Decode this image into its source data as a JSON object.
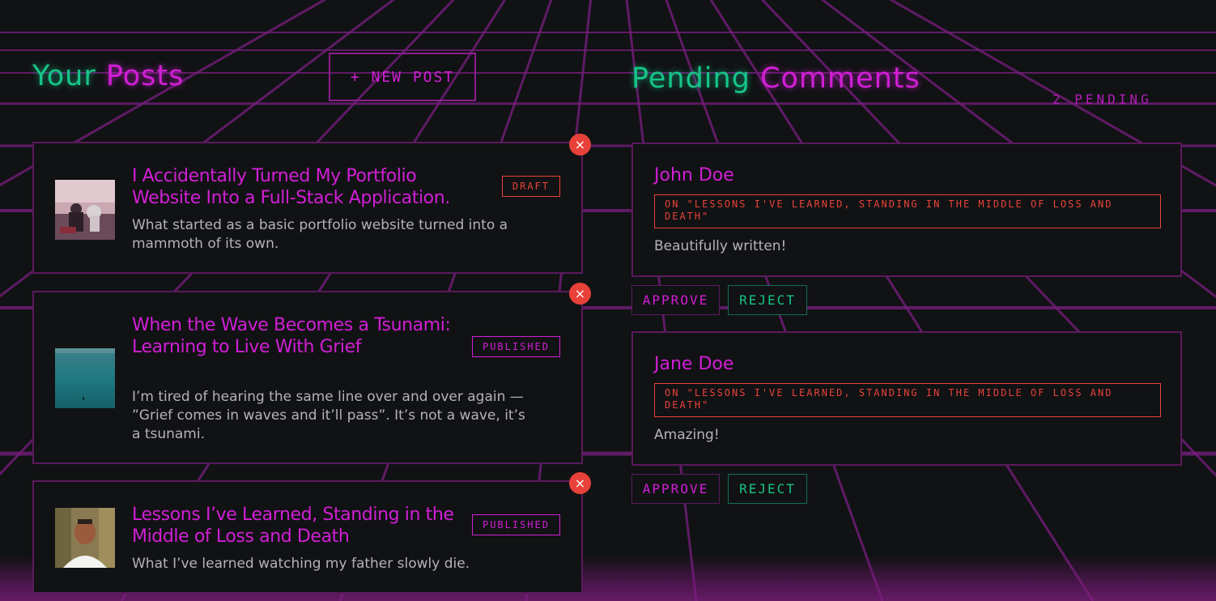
{
  "colors": {
    "background": "#111214",
    "neon_magenta": "#d21fd6",
    "neon_green": "#16c489",
    "alert_red": "#e8433a",
    "card_border": "#5a1a5c",
    "grid_line": "#7a1f80"
  },
  "posts_section": {
    "title_part1": "Your",
    "title_part2": "Posts",
    "new_post_label": "+ NEW POST",
    "posts": [
      {
        "title": "I Accidentally Turned My Portfolio Website Into a Full-Stack Application.",
        "excerpt": "What started as a basic portfolio website turned into a mammoth of its own.",
        "status": "DRAFT",
        "thumbnail": "illustrated-scene-thumbnail",
        "delete_icon": "×"
      },
      {
        "title": "When the Wave Becomes a Tsunami: Learning to Live With Grief",
        "excerpt": "I’m tired of hearing the same line over and over again — ”Grief comes in waves and it’ll pass”. It’s not a wave, it’s a tsunami.",
        "status": "PUBLISHED",
        "thumbnail": "ocean-thumbnail",
        "delete_icon": "×"
      },
      {
        "title": "Lessons I’ve Learned, Standing in the Middle of Loss and Death",
        "excerpt": "What I’ve learned watching my father slowly die.",
        "status": "PUBLISHED",
        "thumbnail": "portrait-thumbnail",
        "delete_icon": "×"
      }
    ]
  },
  "comments_section": {
    "title_part1": "Pending",
    "title_part2": "Comments",
    "pending_count": "2 PENDING",
    "comments": [
      {
        "author": "John Doe",
        "reference": "ON \"LESSONS I'VE LEARNED, STANDING IN THE MIDDLE OF LOSS AND DEATH\"",
        "body": "Beautifully written!",
        "approve_label": "APPROVE",
        "reject_label": "REJECT"
      },
      {
        "author": "Jane Doe",
        "reference": "ON \"LESSONS I'VE LEARNED, STANDING IN THE MIDDLE OF LOSS AND DEATH\"",
        "body": "Amazing!",
        "approve_label": "APPROVE",
        "reject_label": "REJECT"
      }
    ]
  }
}
